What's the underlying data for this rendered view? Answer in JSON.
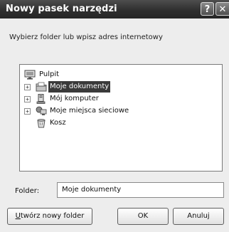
{
  "window": {
    "title": "Nowy pasek narzędzi",
    "help_glyph": "?",
    "close_glyph": "✕"
  },
  "prompt": "Wybierz folder lub wpisz adres internetowy",
  "tree": {
    "items": [
      {
        "label": "Pulpit",
        "icon": "desktop-icon",
        "expandable": false,
        "selected": false
      },
      {
        "label": "Moje dokumenty",
        "icon": "folder-documents-icon",
        "expandable": true,
        "expander": "+",
        "selected": true
      },
      {
        "label": "Mój komputer",
        "icon": "computer-icon",
        "expandable": true,
        "expander": "+",
        "selected": false
      },
      {
        "label": "Moje miejsca sieciowe",
        "icon": "network-places-icon",
        "expandable": true,
        "expander": "+",
        "selected": false
      },
      {
        "label": "Kosz",
        "icon": "recycle-bin-icon",
        "expandable": false,
        "selected": false
      }
    ]
  },
  "folder_field": {
    "label": "Folder:",
    "value": "Moje dokumenty"
  },
  "buttons": {
    "new_folder": "Utwórz nowy folder",
    "ok": "OK",
    "cancel": "Anuluj"
  },
  "colors": {
    "titlebar": "#2f2f2f",
    "selection": "#3a3a3a",
    "dialog_bg": "#ededed"
  }
}
